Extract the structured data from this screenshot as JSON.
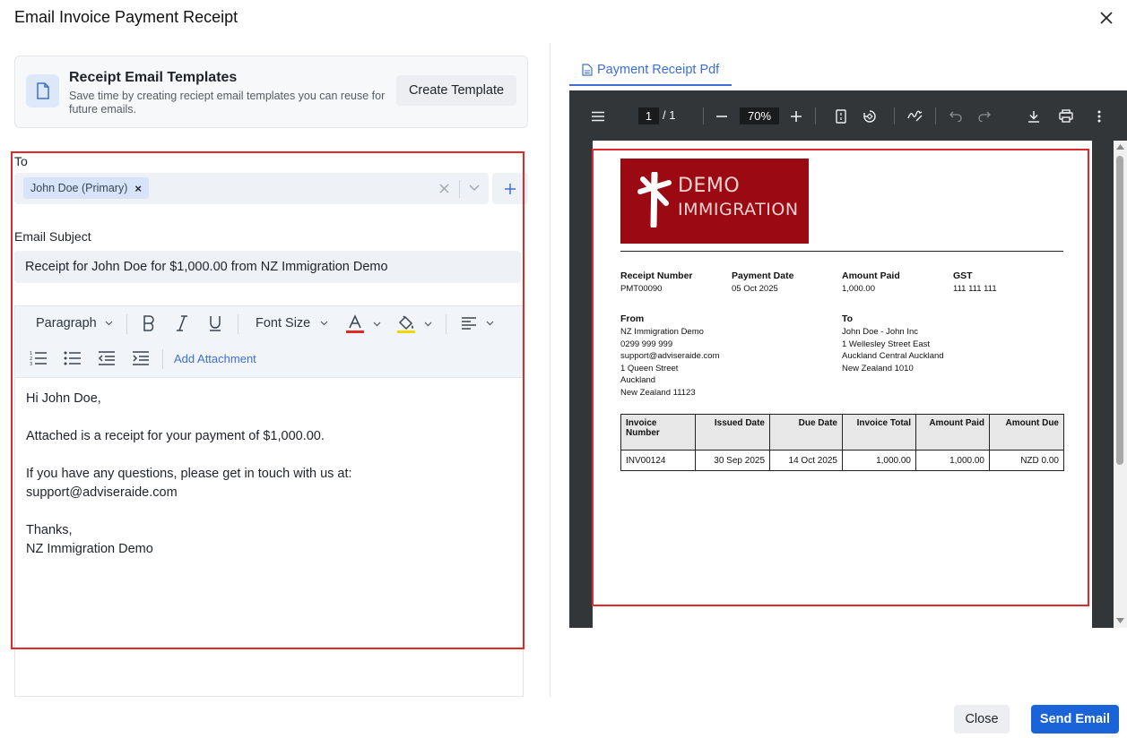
{
  "dialog": {
    "title": "Email Invoice Payment Receipt"
  },
  "templates": {
    "title": "Receipt Email Templates",
    "description": "Save time by creating reciept email templates you can reuse for future emails.",
    "create_button": "Create Template"
  },
  "form": {
    "to_label": "To",
    "recipients": [
      "John Doe (Primary)"
    ],
    "subject_label": "Email Subject",
    "subject_value": "Receipt for John Doe for $1,000.00 from NZ Immigration Demo"
  },
  "editor": {
    "paragraph_label": "Paragraph",
    "font_size_label": "Font Size",
    "add_attachment": "Add Attachment",
    "colors": {
      "text_color": "#e02a2a",
      "highlight_color": "#f2d600"
    },
    "body": {
      "greeting": "Hi John Doe,",
      "line1": "Attached is a receipt for your payment of $1,000.00.",
      "line2a": "If you have any questions, please get in touch with us at:",
      "line2b": "support@adviseraide.com",
      "signoff": "Thanks,",
      "signature": "NZ Immigration Demo"
    }
  },
  "pdf_tab": {
    "label": "Payment Receipt Pdf"
  },
  "viewer": {
    "page_current": "1",
    "page_total": "/ 1",
    "zoom": "70%"
  },
  "receipt": {
    "logo_line1": "DEMO",
    "logo_line2": "IMMIGRATION",
    "receipt_number_label": "Receipt Number",
    "receipt_number": "PMT00090",
    "payment_date_label": "Payment Date",
    "payment_date": "05 Oct 2025",
    "amount_paid_label": "Amount Paid",
    "amount_paid": "1,000.00",
    "gst_label": "GST",
    "gst": "111 111 111",
    "from_label": "From",
    "from_lines": [
      "NZ Immigration Demo",
      "0299 999 999",
      "support@adviseraide.com",
      "1 Queen Street",
      "Auckland",
      "New Zealand 11123"
    ],
    "to_label": "To",
    "to_lines": [
      "John Doe - John Inc",
      "1 Wellesley Street East",
      "Auckland Central Auckland",
      "New Zealand 1010"
    ],
    "table": {
      "headers": [
        "Invoice Number",
        "Issued Date",
        "Due Date",
        "Invoice Total",
        "Amount Paid",
        "Amount Due"
      ],
      "rows": [
        [
          "INV00124",
          "30 Sep 2025",
          "14 Oct 2025",
          "1,000.00",
          "1,000.00",
          "NZD 0.00"
        ]
      ]
    }
  },
  "footer": {
    "close_label": "Close",
    "send_label": "Send Email"
  },
  "theme": {
    "accent": "#1a63d8",
    "highlight_border": "#e02a2a",
    "logo_bg": "#9b0a12"
  }
}
